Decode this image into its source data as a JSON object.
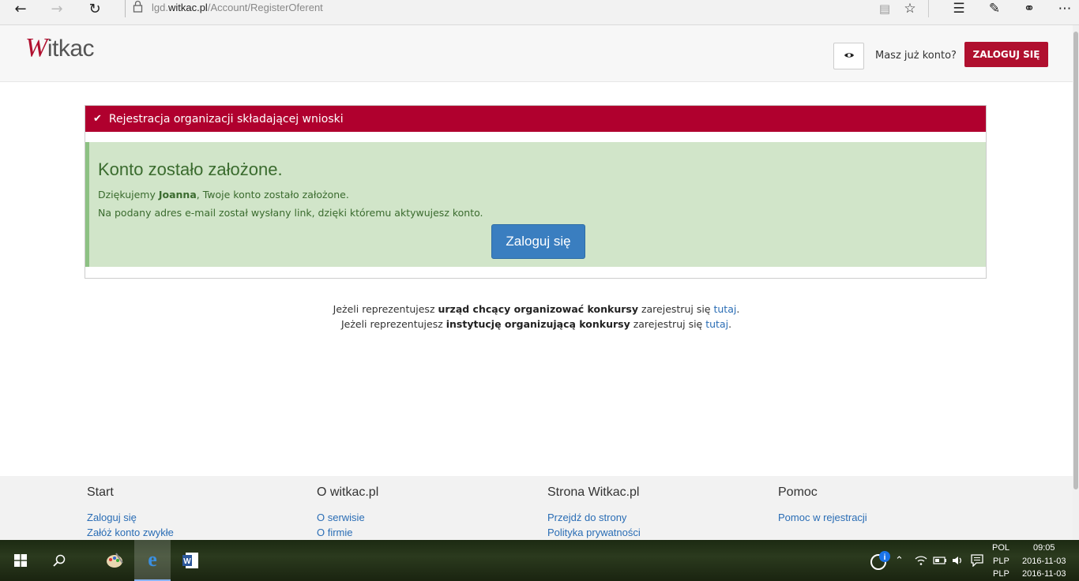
{
  "browser": {
    "url_prefix": "lgd.",
    "url_domain": "witkac.pl",
    "url_path": "/Account/RegisterOferent"
  },
  "header": {
    "logo_initial": "W",
    "logo_rest": "itkac",
    "have_account": "Masz już konto?",
    "login_button": "ZALOGUJ SIĘ"
  },
  "panel": {
    "title": "Rejestracja organizacji składającej wnioski",
    "success_title": "Konto zostało założone.",
    "thanks_prefix": "Dziękujemy ",
    "user_name": "Joanna",
    "thanks_suffix": ", Twoje konto zostało założone.",
    "email_info": "Na podany adres e-mail został wysłany link, dzięki któremu aktywujesz konto.",
    "login_button": "Zaloguj się"
  },
  "notes": [
    {
      "prefix": "Jeżeli reprezentujesz ",
      "bold": "urząd chcący organizować konkursy",
      "middle": " zarejestruj się ",
      "link": "tutaj",
      "suffix": "."
    },
    {
      "prefix": "Jeżeli reprezentujesz ",
      "bold": "instytucję organizującą konkursy",
      "middle": " zarejestruj się ",
      "link": "tutaj",
      "suffix": "."
    }
  ],
  "footer": {
    "columns": [
      {
        "title": "Start",
        "links": [
          "Zaloguj się",
          "Załóż konto zwykłe"
        ]
      },
      {
        "title": "O witkac.pl",
        "links": [
          "O serwisie",
          "O firmie"
        ]
      },
      {
        "title": "Strona Witkac.pl",
        "links": [
          "Przejdź do strony",
          "Polityka prywatności"
        ]
      },
      {
        "title": "Pomoc",
        "links": [
          "Pomoc w rejestracji"
        ]
      }
    ]
  },
  "taskbar": {
    "lang_1": "POL",
    "lang_2": "PLP",
    "lang_3": "PLP",
    "time": "09:05",
    "date": "2016-11-03",
    "date_2": "2016-11-03"
  },
  "colors": {
    "brand": "#b0002e",
    "success_bg": "#d1e5c9",
    "primary_button": "#3a7ec0",
    "link": "#2a6db5"
  }
}
